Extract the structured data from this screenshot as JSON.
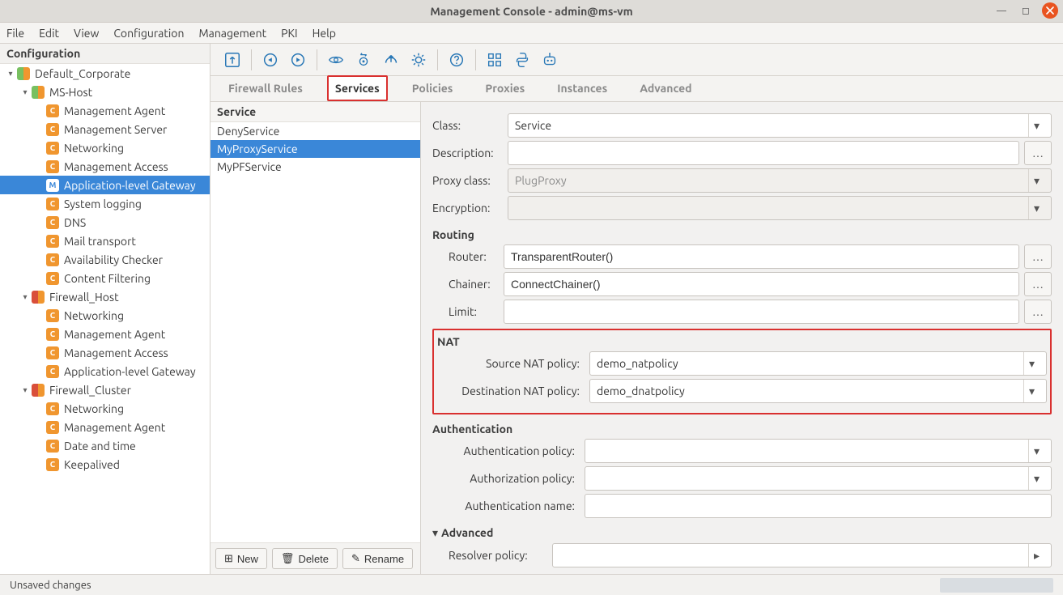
{
  "window": {
    "title": "Management Console - admin@ms-vm"
  },
  "menubar": [
    "File",
    "Edit",
    "View",
    "Configuration",
    "Management",
    "PKI",
    "Help"
  ],
  "sidebar": {
    "header": "Configuration",
    "tree": [
      {
        "depth": 0,
        "exp": "▾",
        "icon": "pair-go",
        "label": "Default_Corporate"
      },
      {
        "depth": 1,
        "exp": "▾",
        "icon": "pair-go",
        "label": "MS-Host"
      },
      {
        "depth": 2,
        "exp": "",
        "icon": "c",
        "label": "Management Agent"
      },
      {
        "depth": 2,
        "exp": "",
        "icon": "c",
        "label": "Management Server"
      },
      {
        "depth": 2,
        "exp": "",
        "icon": "c",
        "label": "Networking"
      },
      {
        "depth": 2,
        "exp": "",
        "icon": "c",
        "label": "Management Access"
      },
      {
        "depth": 2,
        "exp": "",
        "icon": "m",
        "label": "Application-level Gateway",
        "selected": true
      },
      {
        "depth": 2,
        "exp": "",
        "icon": "c",
        "label": "System logging"
      },
      {
        "depth": 2,
        "exp": "",
        "icon": "c",
        "label": "DNS"
      },
      {
        "depth": 2,
        "exp": "",
        "icon": "c",
        "label": "Mail transport"
      },
      {
        "depth": 2,
        "exp": "",
        "icon": "c",
        "label": "Availability Checker"
      },
      {
        "depth": 2,
        "exp": "",
        "icon": "c",
        "label": "Content Filtering"
      },
      {
        "depth": 1,
        "exp": "▾",
        "icon": "pair-ro",
        "label": "Firewall_Host"
      },
      {
        "depth": 2,
        "exp": "",
        "icon": "c",
        "label": "Networking"
      },
      {
        "depth": 2,
        "exp": "",
        "icon": "c",
        "label": "Management Agent"
      },
      {
        "depth": 2,
        "exp": "",
        "icon": "c",
        "label": "Management Access"
      },
      {
        "depth": 2,
        "exp": "",
        "icon": "c",
        "label": "Application-level Gateway"
      },
      {
        "depth": 1,
        "exp": "▾",
        "icon": "pair-ro",
        "label": "Firewall_Cluster"
      },
      {
        "depth": 2,
        "exp": "",
        "icon": "c",
        "label": "Networking"
      },
      {
        "depth": 2,
        "exp": "",
        "icon": "c",
        "label": "Management Agent"
      },
      {
        "depth": 2,
        "exp": "",
        "icon": "c",
        "label": "Date and time"
      },
      {
        "depth": 2,
        "exp": "",
        "icon": "c",
        "label": "Keepalived"
      }
    ]
  },
  "tabs": [
    {
      "label": "Firewall Rules"
    },
    {
      "label": "Services",
      "active": true
    },
    {
      "label": "Policies"
    },
    {
      "label": "Proxies"
    },
    {
      "label": "Instances"
    },
    {
      "label": "Advanced"
    }
  ],
  "services": {
    "header": "Service",
    "items": [
      {
        "label": "DenyService"
      },
      {
        "label": "MyProxyService",
        "selected": true
      },
      {
        "label": "MyPFService"
      }
    ],
    "actions": {
      "new": "New",
      "delete": "Delete",
      "rename": "Rename"
    }
  },
  "form": {
    "class_label": "Class:",
    "class_value": "Service",
    "description_label": "Description:",
    "description_value": "",
    "proxy_class_label": "Proxy class:",
    "proxy_class_value": "PlugProxy",
    "encryption_label": "Encryption:",
    "encryption_value": "",
    "routing_title": "Routing",
    "router_label": "Router:",
    "router_value": "TransparentRouter()",
    "chainer_label": "Chainer:",
    "chainer_value": "ConnectChainer()",
    "limit_label": "Limit:",
    "limit_value": "",
    "nat_title": "NAT",
    "src_nat_label": "Source NAT policy:",
    "src_nat_value": "demo_natpolicy",
    "dst_nat_label": "Destination NAT policy:",
    "dst_nat_value": "demo_dnatpolicy",
    "auth_title": "Authentication",
    "auth_policy_label": "Authentication policy:",
    "auth_policy_value": "",
    "authz_policy_label": "Authorization policy:",
    "authz_policy_value": "",
    "auth_name_label": "Authentication name:",
    "auth_name_value": "",
    "advanced_title": "Advanced",
    "resolver_label": "Resolver policy:",
    "resolver_value": ""
  },
  "status": {
    "left": "Unsaved changes"
  }
}
